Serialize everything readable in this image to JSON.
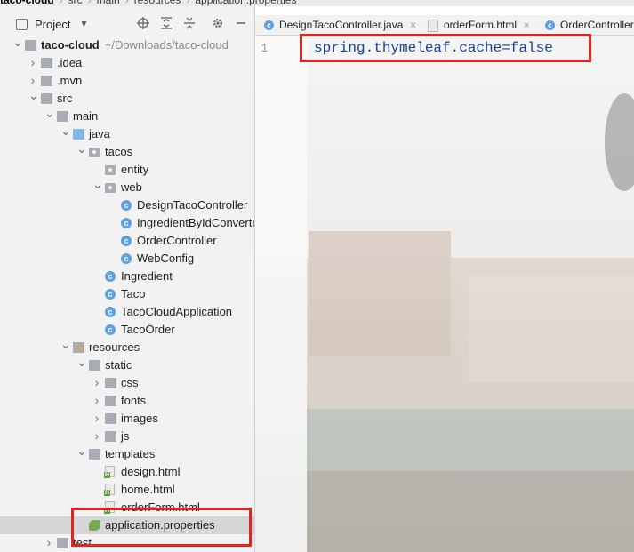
{
  "breadcrumb": [
    "taco-cloud",
    "src",
    "main",
    "resources",
    "application.properties"
  ],
  "project_panel": {
    "title": "Project",
    "tools": [
      "locate-icon",
      "expand-all-icon",
      "collapse-all-icon",
      "gear-icon",
      "minimize-icon"
    ]
  },
  "tree": [
    {
      "label": "taco-cloud",
      "path": "~/Downloads/taco-cloud",
      "depth": 0,
      "icon": "folder",
      "expanded": true,
      "bold": true
    },
    {
      "label": ".idea",
      "depth": 1,
      "icon": "folder",
      "expanded": false
    },
    {
      "label": ".mvn",
      "depth": 1,
      "icon": "folder",
      "expanded": false
    },
    {
      "label": "src",
      "depth": 1,
      "icon": "folder",
      "expanded": true
    },
    {
      "label": "main",
      "depth": 2,
      "icon": "folder",
      "expanded": true
    },
    {
      "label": "java",
      "depth": 3,
      "icon": "folder-blue",
      "expanded": true
    },
    {
      "label": "tacos",
      "depth": 4,
      "icon": "package",
      "expanded": true
    },
    {
      "label": "entity",
      "depth": 5,
      "icon": "package"
    },
    {
      "label": "web",
      "depth": 5,
      "icon": "package",
      "expanded": true
    },
    {
      "label": "DesignTacoController",
      "depth": 6,
      "icon": "class"
    },
    {
      "label": "IngredientByIdConverter",
      "depth": 6,
      "icon": "class"
    },
    {
      "label": "OrderController",
      "depth": 6,
      "icon": "class"
    },
    {
      "label": "WebConfig",
      "depth": 6,
      "icon": "class"
    },
    {
      "label": "Ingredient",
      "depth": 5,
      "icon": "class"
    },
    {
      "label": "Taco",
      "depth": 5,
      "icon": "class"
    },
    {
      "label": "TacoCloudApplication",
      "depth": 5,
      "icon": "class"
    },
    {
      "label": "TacoOrder",
      "depth": 5,
      "icon": "class"
    },
    {
      "label": "resources",
      "depth": 3,
      "icon": "resources",
      "expanded": true
    },
    {
      "label": "static",
      "depth": 4,
      "icon": "folder",
      "expanded": true
    },
    {
      "label": "css",
      "depth": 5,
      "icon": "folder",
      "expanded": false
    },
    {
      "label": "fonts",
      "depth": 5,
      "icon": "folder",
      "expanded": false
    },
    {
      "label": "images",
      "depth": 5,
      "icon": "folder",
      "expanded": false
    },
    {
      "label": "js",
      "depth": 5,
      "icon": "folder",
      "expanded": false
    },
    {
      "label": "templates",
      "depth": 4,
      "icon": "folder",
      "expanded": true
    },
    {
      "label": "design.html",
      "depth": 5,
      "icon": "html"
    },
    {
      "label": "home.html",
      "depth": 5,
      "icon": "html"
    },
    {
      "label": "orderForm.html",
      "depth": 5,
      "icon": "html"
    },
    {
      "label": "application.properties",
      "depth": 4,
      "icon": "properties",
      "selected": true
    },
    {
      "label": "test",
      "depth": 2,
      "icon": "folder",
      "expanded": false
    }
  ],
  "tabs": [
    {
      "label": "DesignTacoController.java",
      "icon": "class"
    },
    {
      "label": "orderForm.html",
      "icon": "html"
    },
    {
      "label": "OrderController",
      "icon": "class"
    }
  ],
  "editor": {
    "line_number": "1",
    "code": "spring.thymeleaf.cache=false"
  },
  "colors": {
    "highlight": "#e02424",
    "code": "#1a3d9b",
    "selection": "#d6d6d6"
  }
}
